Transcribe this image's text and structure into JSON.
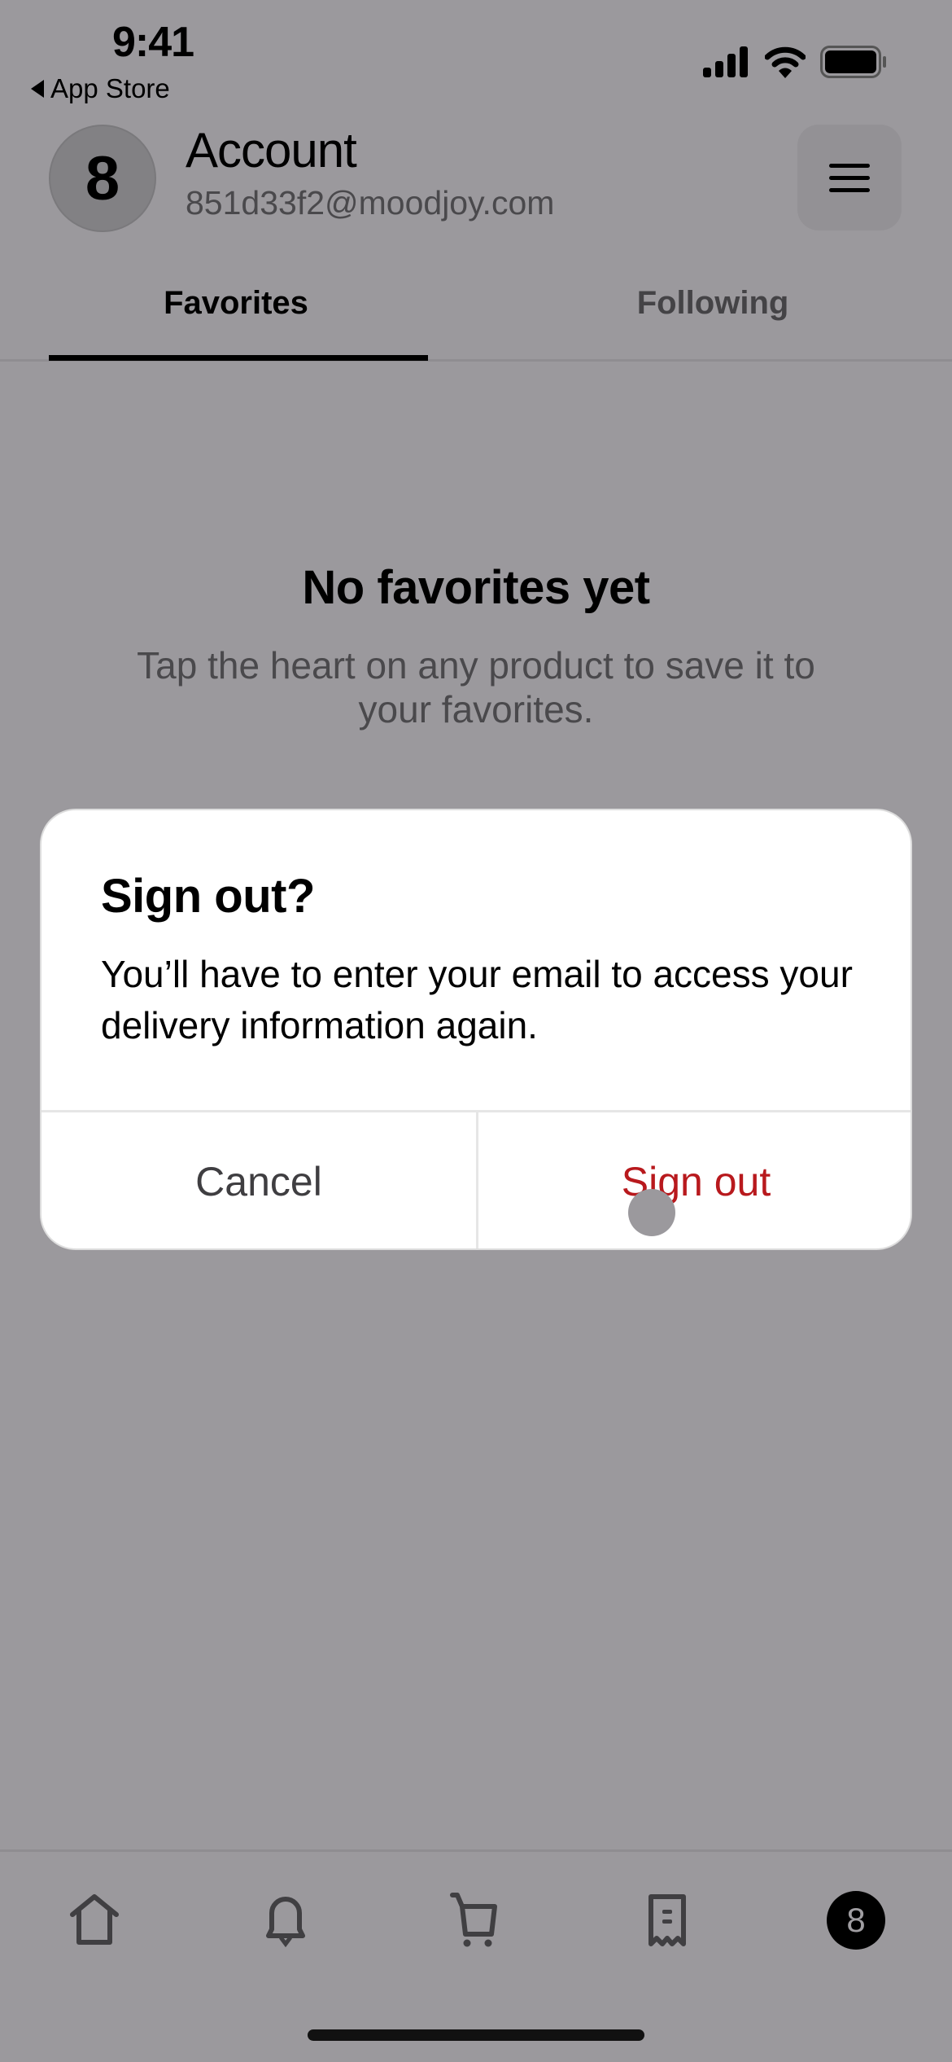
{
  "status_bar": {
    "time": "9:41",
    "back_app_label": "App Store",
    "icons": [
      "cellular-signal-icon",
      "wifi-icon",
      "battery-icon"
    ]
  },
  "header": {
    "avatar_initial": "8",
    "title": "Account",
    "email": "851d33f2@moodjoy.com",
    "menu_icon": "hamburger-menu-icon"
  },
  "tabs": [
    {
      "label": "Favorites",
      "active": true
    },
    {
      "label": "Following",
      "active": false
    }
  ],
  "empty_state": {
    "title": "No favorites yet",
    "description": "Tap the heart on any product to save it to your favorites."
  },
  "dialog": {
    "title": "Sign out?",
    "message": "You’ll have to enter your email to access your delivery information again.",
    "cancel_label": "Cancel",
    "confirm_label": "Sign out",
    "confirm_color": "#b8191d"
  },
  "bottom_nav": {
    "items": [
      {
        "name": "home",
        "icon": "home-icon"
      },
      {
        "name": "notifications",
        "icon": "bell-icon"
      },
      {
        "name": "cart",
        "icon": "cart-icon"
      },
      {
        "name": "orders",
        "icon": "receipt-icon"
      },
      {
        "name": "account",
        "icon": "avatar-icon",
        "label": "8"
      }
    ]
  },
  "colors": {
    "overlay_background": "#9b999d",
    "destructive": "#b8191d"
  }
}
